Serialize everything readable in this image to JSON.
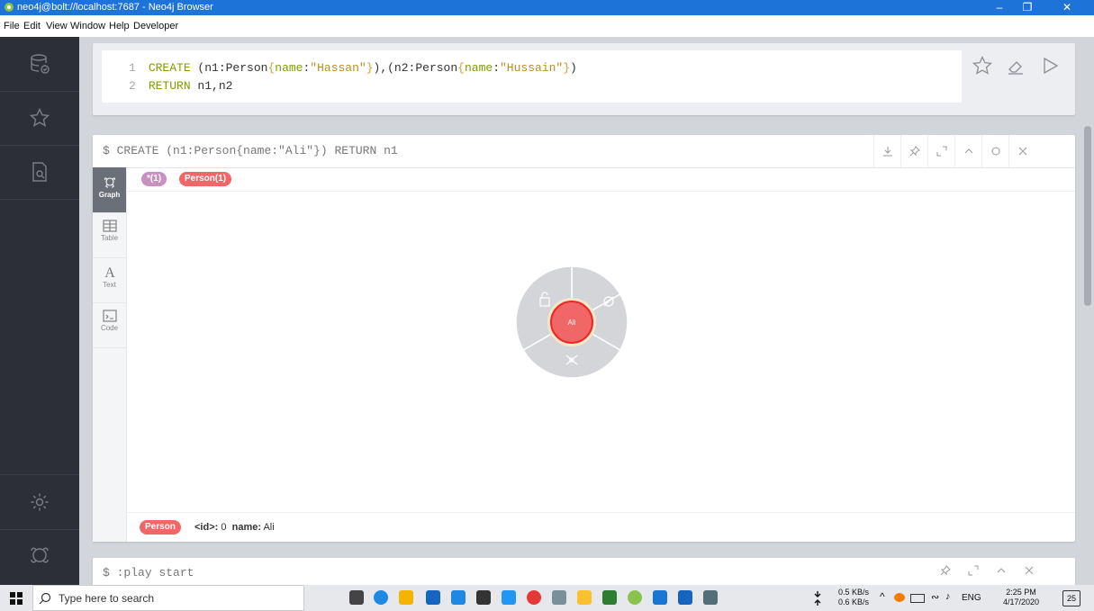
{
  "window": {
    "title": "neo4j@bolt://localhost:7687 - Neo4j Browser"
  },
  "menu": [
    "File",
    "Edit",
    "View",
    "Window",
    "Help",
    "Developer"
  ],
  "editor": {
    "lines": [
      {
        "num": "1",
        "kw": "CREATE",
        "text": "CREATE (n1:Person{name:\"Hassan\"}),(n2:Person{name:\"Hussain\"})"
      },
      {
        "num": "2",
        "kw": "RETURN",
        "text": "RETURN n1,n2"
      }
    ]
  },
  "frame": {
    "prompt": "$",
    "query": "CREATE (n1:Person{name:\"Ali\"}) RETURN n1",
    "tabs": [
      "Graph",
      "Table",
      "Text",
      "Code"
    ],
    "legend": [
      {
        "label": "*(1)",
        "color": "#c990c0"
      },
      {
        "label": "Person(1)",
        "color": "#f16667"
      }
    ],
    "node": {
      "label": "Ali",
      "color": "#f16667",
      "border": "#eb2728"
    },
    "status": {
      "label": "Person",
      "id_key": "<id>:",
      "id_value": "0",
      "name_key": "name:",
      "name_value": "Ali"
    }
  },
  "frame2": {
    "prompt": "$",
    "query": ":play start"
  },
  "taskbar": {
    "search_placeholder": "Type here to search",
    "net_up": "0.5 KB/s",
    "net_down": "0.6 KB/s",
    "language": "ENG",
    "time": "2:25 PM",
    "date": "4/17/2020",
    "notification_count": "25"
  }
}
